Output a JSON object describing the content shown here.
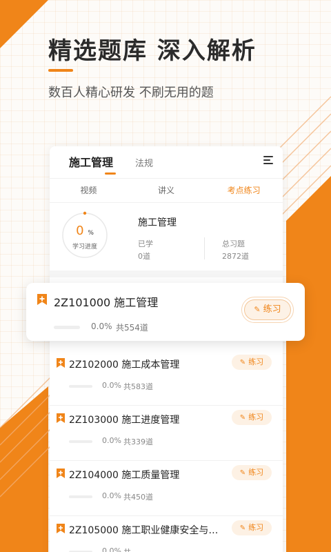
{
  "promo": {
    "headline": "精选题库  深入解析",
    "subtitle": "数百人精心研发  不刷无用的题"
  },
  "app": {
    "top_tabs": [
      {
        "label": "施工管理",
        "active": true
      },
      {
        "label": "法规",
        "active": false
      }
    ],
    "sub_tabs": [
      {
        "label": "视频",
        "active": false
      },
      {
        "label": "讲义",
        "active": false
      },
      {
        "label": "考点练习",
        "active": true
      }
    ],
    "progress": {
      "value": "0",
      "unit": "%",
      "label": "学习进度",
      "fraction": 0
    },
    "subject": {
      "name": "施工管理",
      "learned_label": "已学",
      "learned_value": "0道",
      "total_label": "总习题",
      "total_value": "2872道"
    },
    "highlighted_chapter": {
      "title": "2Z101000 施工管理",
      "percent": "0.0%",
      "total": "共554道",
      "button": "练习"
    },
    "chapters": [
      {
        "title": "2Z102000 施工成本管理",
        "percent": "0.0%",
        "total": "共583道",
        "button": "练习"
      },
      {
        "title": "2Z103000 施工进度管理",
        "percent": "0.0%",
        "total": "共339道",
        "button": "练习"
      },
      {
        "title": "2Z104000 施工质量管理",
        "percent": "0.0%",
        "total": "共450道",
        "button": "练习"
      },
      {
        "title": "2Z105000 施工职业健康安全与…",
        "percent": "0.0%",
        "total": "共…",
        "button": "练习"
      }
    ]
  },
  "colors": {
    "accent": "#f08519",
    "accent_light": "#fdf1e4"
  },
  "icons": {
    "bookmark": "bookmark-plus-icon",
    "menu": "menu-icon",
    "pen": "pen-icon"
  }
}
